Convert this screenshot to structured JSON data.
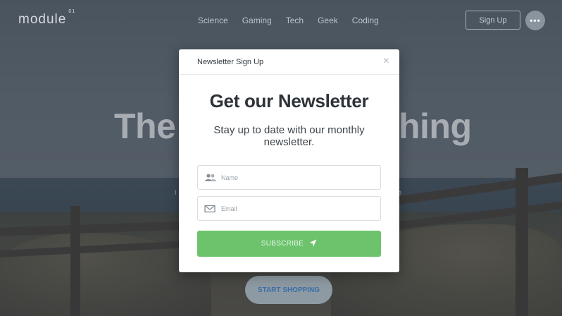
{
  "nav": {
    "logo": "module",
    "logo_sup": "01",
    "links": [
      "Science",
      "Gaming",
      "Tech",
      "Geek",
      "Coding"
    ],
    "signup_label": "Sign Up",
    "more_label": "•••"
  },
  "hero": {
    "title_left": "The",
    "title_right": "hing",
    "small_left": "I",
    "small_right": "e",
    "shop_label": "START SHOPPING"
  },
  "modal": {
    "title": "Newsletter Sign Up",
    "close_glyph": "×",
    "headline": "Get our Newsletter",
    "subline": "Stay up to date with our monthly newsletter.",
    "name_placeholder": "Name",
    "email_placeholder": "Email",
    "subscribe_label": "SUBSCRIBE",
    "colors": {
      "subscribe": "#6cc36c"
    }
  }
}
